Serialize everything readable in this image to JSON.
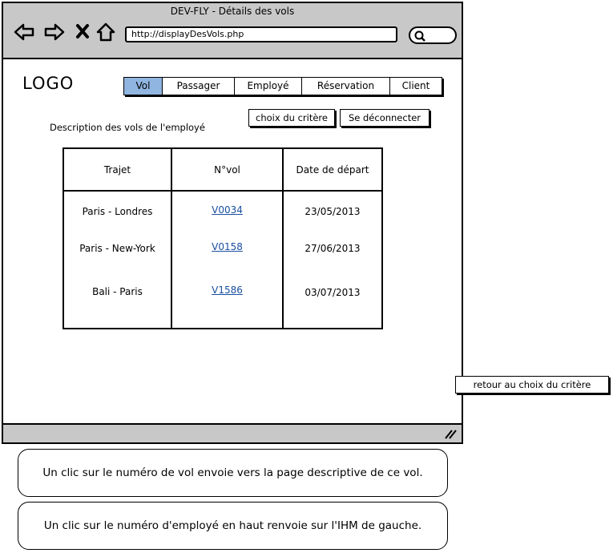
{
  "window": {
    "title": "DEV-FLY - Détails des vols",
    "url": "http://displayDesVols.php"
  },
  "logo": "LOGO",
  "tabs": [
    "Vol",
    "Passager",
    "Employé",
    "Réservation",
    "Client"
  ],
  "active_tab": "Vol",
  "page": {
    "description": "Description des vols de l'employé",
    "choose_criterion_label": "choix du critère",
    "logout_label": "Se déconnecter",
    "back_label": "retour au choix du critère"
  },
  "table": {
    "headers": [
      "Trajet",
      "N°vol",
      "Date de départ"
    ],
    "rows": [
      {
        "route": "Paris - Londres",
        "flight": "V0034",
        "date": "23/05/2013"
      },
      {
        "route": "Paris - New-York",
        "flight": "V0158",
        "date": "27/06/2013"
      },
      {
        "route": "Bali - Paris",
        "flight": "V1586",
        "date": "03/07/2013"
      }
    ]
  },
  "notes": [
    "Un clic sur le numéro de vol envoie vers la page descriptive de ce vol.",
    "Un clic sur le numéro d'employé en haut renvoie sur l'IHM de gauche."
  ],
  "colors": {
    "chrome": "#c8c8c8",
    "active_tab": "#8fb5e0",
    "link": "#1a4fa0"
  }
}
